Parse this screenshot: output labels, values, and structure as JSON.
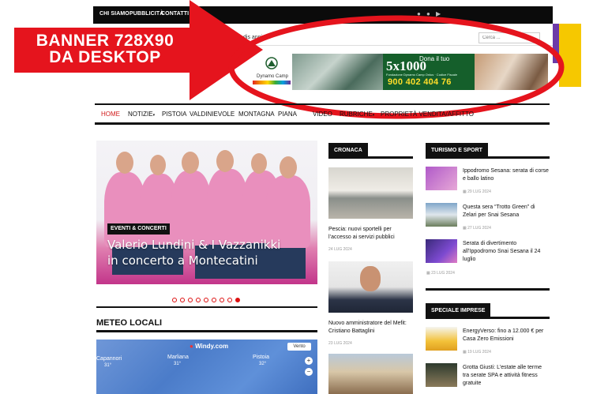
{
  "topbar": {
    "links": [
      "CHI SIAMO",
      "PUBBLICITÀ",
      "CONTATTI"
    ]
  },
  "ticker": {
    "text": "ggio alle dis       anni '90"
  },
  "search": {
    "placeholder": "Cerca ..."
  },
  "ad": {
    "logo_name": "Dynamo Camp",
    "donate_label": "Dona il tuo",
    "donate_big": "5x1000",
    "donate_small": "Fondazione Dynamo Camp Onlus · Codice Fiscale",
    "phone": "900 402 404 76"
  },
  "overlay": {
    "label": "BANNER 728X90 DA DESKTOP",
    "color": "#e5141d"
  },
  "nav": {
    "items": [
      "HOME",
      "NOTIZIE",
      "PISTOIA",
      "VALDINIEVOLE",
      "MONTAGNA",
      "PIANA",
      "VIDEO",
      "RUBRICHE",
      "PROPRIETÀ VENDITA/AFFITTO"
    ],
    "active_color": "#d11a1a"
  },
  "hero": {
    "category": "EVENTI & CONCERTI",
    "title": "Valerio Lundini & I Vazzanikki in concerto a Montecatini",
    "slides": 9,
    "active_slide": 9
  },
  "meteo": {
    "title": "METEO LOCALI",
    "windy": "Windy.com",
    "vento": "Vento",
    "cities": [
      {
        "name": "Capannori",
        "temp": "31°"
      },
      {
        "name": "Marliana",
        "temp": "31°"
      },
      {
        "name": "Pistoia",
        "temp": "32°"
      }
    ]
  },
  "cronaca": {
    "header": "CRONACA",
    "items": [
      {
        "title": "Pescia: nuovi sportelli per l’accesso ai servizi pubblici",
        "date": "24 LUG 2024"
      },
      {
        "title": "Nuovo amministratore del Mefit: Cristiano Battaglini",
        "date": "23 LUG 2024"
      }
    ]
  },
  "turismo": {
    "header": "TURISMO E SPORT",
    "items": [
      {
        "title": "Ippodromo Sesana: serata di corse e ballo latino",
        "date": "29 LUG 2024"
      },
      {
        "title": "Questa sera “Trotto Green” di Zelari per Snai Sesana",
        "date": "27 LUG 2024"
      },
      {
        "title": "Serata di divertimento all’Ippodromo Snai Sesana il 24 luglio",
        "date": "23 LUG 2024"
      }
    ]
  },
  "speciale": {
    "header": "SPECIALE IMPRESE",
    "items": [
      {
        "title": "EnergyVerso: fino a 12.000 € per Casa Zero Emissioni",
        "date": "19 LUG 2024"
      },
      {
        "title": "Grotta Giusti: L’estate alle terme tra serate SPA e attività fitness gratuite",
        "date": ""
      }
    ]
  }
}
